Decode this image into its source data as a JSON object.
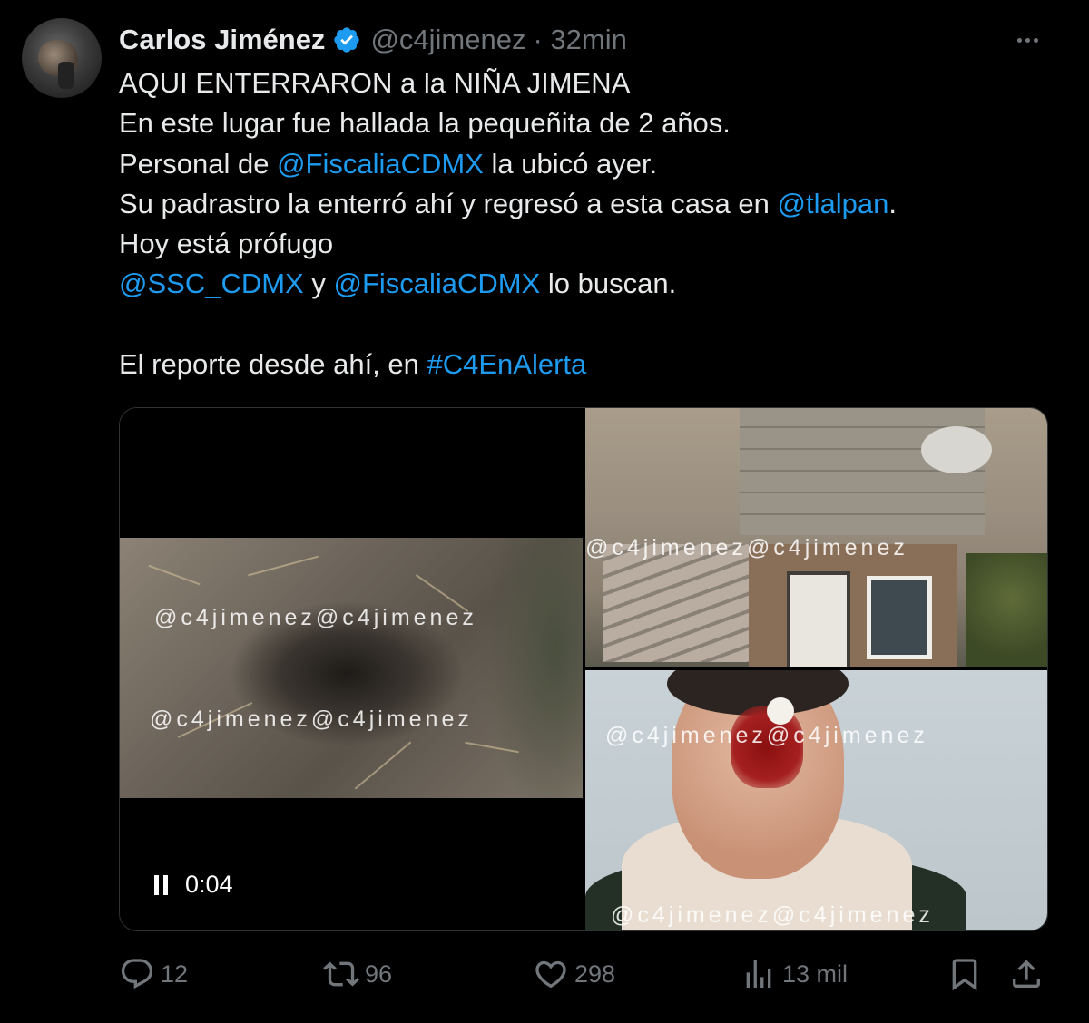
{
  "author": {
    "name": "Carlos Jiménez",
    "handle": "@c4jimenez",
    "time": "· 32min"
  },
  "tweet": {
    "lines": [
      [
        {
          "t": "AQUI ENTERRARON a la NIÑA JIMENA"
        }
      ],
      [
        {
          "t": "En este lugar fue hallada la pequeñita de 2 años."
        }
      ],
      [
        {
          "t": "Personal de "
        },
        {
          "t": "@FiscaliaCDMX",
          "link": true
        },
        {
          "t": " la ubicó ayer."
        }
      ],
      [
        {
          "t": "Su padrastro la enterró ahí y regresó a esta casa en "
        },
        {
          "t": "@tlalpan",
          "link": true
        },
        {
          "t": "."
        }
      ],
      [
        {
          "t": "Hoy está prófugo"
        }
      ],
      [
        {
          "t": "@SSC_CDMX",
          "link": true
        },
        {
          "t": " y "
        },
        {
          "t": "@FiscaliaCDMX",
          "link": true
        },
        {
          "t": " lo buscan."
        }
      ],
      [],
      [
        {
          "t": "El reporte desde ahí, en "
        },
        {
          "t": "#C4EnAlerta",
          "link": true
        }
      ]
    ]
  },
  "media": {
    "watermark": "@c4jimenez@c4jimenez",
    "video_time": "0:04"
  },
  "actions": {
    "replies": "12",
    "reposts": "96",
    "likes": "298",
    "views": "13 mil"
  },
  "colors": {
    "link": "#1d9bf0",
    "muted": "#71767b",
    "verified": "#1d9bf0"
  }
}
